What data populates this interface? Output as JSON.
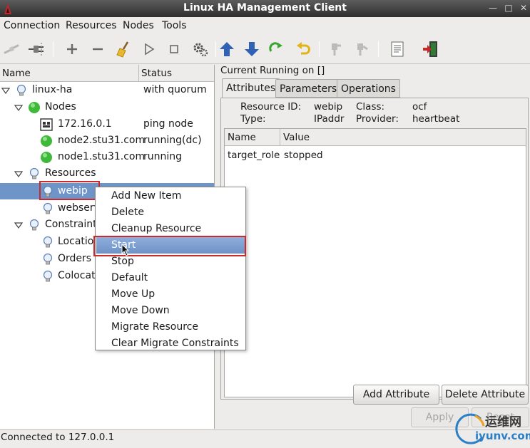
{
  "window": {
    "title": "Linux HA Management Client"
  },
  "menu": [
    "Connection",
    "Resources",
    "Nodes",
    "Tools"
  ],
  "toolbar": {
    "icons": [
      "login-icon",
      "logout-icon",
      "add-icon",
      "remove-icon",
      "cleanup-broom-icon",
      "start-icon",
      "stop-icon",
      "settings-gears-icon",
      "move-up-icon",
      "move-down-icon",
      "refresh-icon",
      "undo-icon",
      "standby-node-icon",
      "active-node-icon",
      "view-xml-icon",
      "exit-icon"
    ]
  },
  "tree": {
    "col_name": "Name",
    "col_status": "Status",
    "rows": [
      {
        "label": "linux-ha",
        "status": "with quorum",
        "icon": "lightbulb-icon"
      },
      {
        "label": "Nodes",
        "status": "",
        "icon": "green-node-icon"
      },
      {
        "label": "172.16.0.1",
        "status": "ping node",
        "icon": "ping-node-icon"
      },
      {
        "label": "node2.stu31.com",
        "status": "running(dc)",
        "icon": "green-node-icon"
      },
      {
        "label": "node1.stu31.com",
        "status": "running",
        "icon": "green-node-icon"
      },
      {
        "label": "Resources",
        "status": "",
        "icon": "lightbulb-icon"
      },
      {
        "label": "webip",
        "status": "",
        "icon": "lightbulb-icon"
      },
      {
        "label": "webserv",
        "status": "",
        "icon": "lightbulb-icon"
      },
      {
        "label": "Constraints",
        "status": "",
        "icon": "lightbulb-icon"
      },
      {
        "label": "Locations",
        "status": "",
        "icon": "lightbulb-icon"
      },
      {
        "label": "Orders",
        "status": "",
        "icon": "lightbulb-icon"
      },
      {
        "label": "Colocations",
        "status": "",
        "icon": "lightbulb-icon"
      }
    ]
  },
  "right": {
    "current_running": "Current Running on []",
    "tabs": [
      "Attributes",
      "Parameters",
      "Operations"
    ],
    "info": {
      "resource_id_label": "Resource ID:",
      "resource_id": "webip",
      "type_label": "Type:",
      "type": "IPaddr",
      "class_label": "Class:",
      "class": "ocf",
      "provider_label": "Provider:",
      "provider": "heartbeat"
    },
    "table": {
      "col_name": "Name",
      "col_value": "Value",
      "rows": [
        {
          "name": "target_role",
          "value": "stopped"
        }
      ]
    },
    "add_attribute": "Add Attribute",
    "delete_attribute": "Delete Attribute",
    "apply": "Apply",
    "reset": "Reset"
  },
  "context_menu": {
    "items": [
      "Add New Item",
      "Delete",
      "Cleanup Resource",
      "Start",
      "Stop",
      "Default",
      "Move Up",
      "Move Down",
      "Migrate Resource",
      "Clear Migrate Constraints"
    ],
    "hovered": "Start"
  },
  "status": "Connected to 127.0.0.1",
  "watermark": {
    "cn": "运维网",
    "en": "iyunv.com"
  }
}
